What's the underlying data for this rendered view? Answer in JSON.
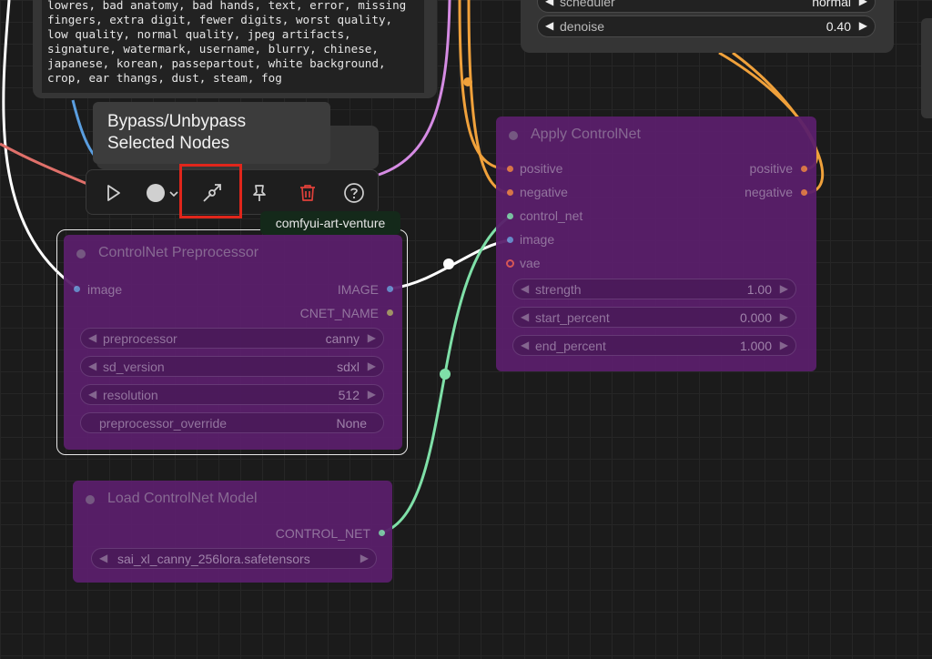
{
  "prompt_node": {
    "text": "lowres, bad anatomy, bad hands, text, error, missing\nfingers, extra digit, fewer digits, worst quality,\nlow quality, normal quality, jpeg artifacts,\nsignature, watermark, username, blurry, chinese,\njapanese, korean, passepartout, white background,\ncrop, ear thangs, dust, steam, fog"
  },
  "sampler_node": {
    "scheduler": {
      "label": "scheduler",
      "value": "normal"
    },
    "denoise": {
      "label": "denoise",
      "value": "0.40"
    }
  },
  "tooltip": {
    "line1": "Bypass/Unbypass",
    "line2": "Selected Nodes"
  },
  "badge": "comfyui-art-venture",
  "apply_controlnet": {
    "title": "Apply ControlNet",
    "inputs": [
      "positive",
      "negative",
      "control_net",
      "image",
      "vae"
    ],
    "outputs": [
      "positive",
      "negative"
    ],
    "widgets": [
      {
        "label": "strength",
        "value": "1.00"
      },
      {
        "label": "start_percent",
        "value": "0.000"
      },
      {
        "label": "end_percent",
        "value": "1.000"
      }
    ]
  },
  "preprocessor": {
    "title": "ControlNet Preprocessor",
    "input": "image",
    "outputs": [
      "IMAGE",
      "CNET_NAME"
    ],
    "widgets": [
      {
        "label": "preprocessor",
        "value": "canny"
      },
      {
        "label": "sd_version",
        "value": "sdxl"
      },
      {
        "label": "resolution",
        "value": "512"
      },
      {
        "label": "preprocessor_override",
        "value": "None"
      }
    ]
  },
  "load_controlnet": {
    "title": "Load ControlNet Model",
    "output": "CONTROL_NET",
    "model": "sai_xl_canny_256lora.safetensors"
  },
  "colors": {
    "node_purple": "#5a1f6b",
    "wire_orange": "#f0a13b",
    "wire_green": "#7fe0a8",
    "wire_white": "#ffffff",
    "wire_pink": "#d58be3",
    "wire_blue": "#5a9ee0",
    "wire_red": "#e0706a",
    "highlight_red": "#e0261b",
    "delete_red": "#e0403a"
  },
  "icons": [
    "play-icon",
    "color-circle-icon",
    "chevron-down-icon",
    "bypass-icon",
    "pin-icon",
    "trash-icon",
    "help-icon"
  ]
}
